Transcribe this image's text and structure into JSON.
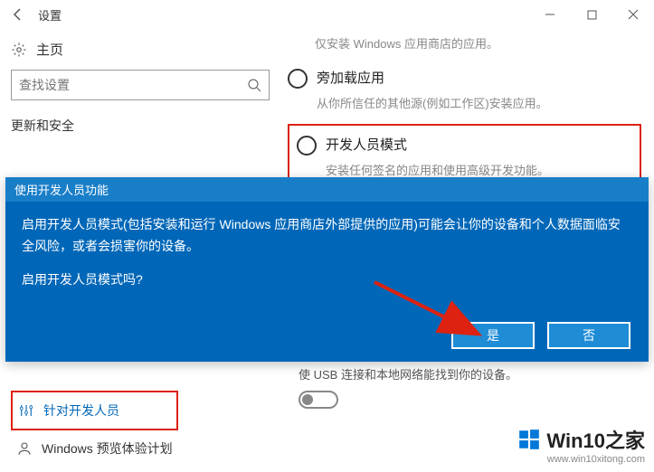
{
  "window": {
    "title": "设置",
    "truncated_top": "仅安装 Windows 应用商店的应用。"
  },
  "sidebar": {
    "home": "主页",
    "search_placeholder": "查找设置",
    "section": "更新和安全",
    "dev_item": "针对开发人员",
    "insider_item": "Windows 预览体验计划"
  },
  "radios": {
    "sideload": {
      "label": "旁加载应用",
      "desc": "从你所信任的其他源(例如工作区)安装应用。"
    },
    "devmode": {
      "label": "开发人员模式",
      "desc": "安装任何签名的应用和使用高级开发功能。"
    }
  },
  "dialog": {
    "title": "使用开发人员功能",
    "body": "启用开发人员模式(包括安装和运行 Windows 应用商店外部提供的应用)可能会让你的设备和个人数据面临安全风险，或者会损害你的设备。",
    "question": "启用开发人员模式吗?",
    "yes": "是",
    "no": "否"
  },
  "below_text": "使 USB 连接和本地网络能找到你的设备。",
  "watermark": {
    "brand": "Win10之家",
    "url": "www.win10xitong.com"
  }
}
